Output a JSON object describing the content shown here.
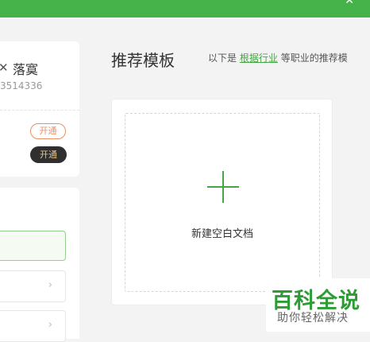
{
  "topbar": {
    "icon": "close-icon"
  },
  "user_card": {
    "name_glyph": "✕",
    "name": "落寞",
    "id": "3514336",
    "open_label_1": "开通",
    "open_label_2": "开通"
  },
  "side_menu": {
    "chevron": "›"
  },
  "main": {
    "heading": "推荐模板",
    "sub_prefix": "以下是",
    "sub_link": "根据行业",
    "sub_suffix": "等职业的推荐模",
    "new_doc_label": "新建空白文档"
  },
  "watermark": {
    "title": "百科全说",
    "subtitle": "助你轻松解决"
  },
  "colors": {
    "brand": "#46b24a",
    "link": "#46a544",
    "accent_orange": "#ec8f63",
    "vip_gold": "#f4c46a"
  }
}
